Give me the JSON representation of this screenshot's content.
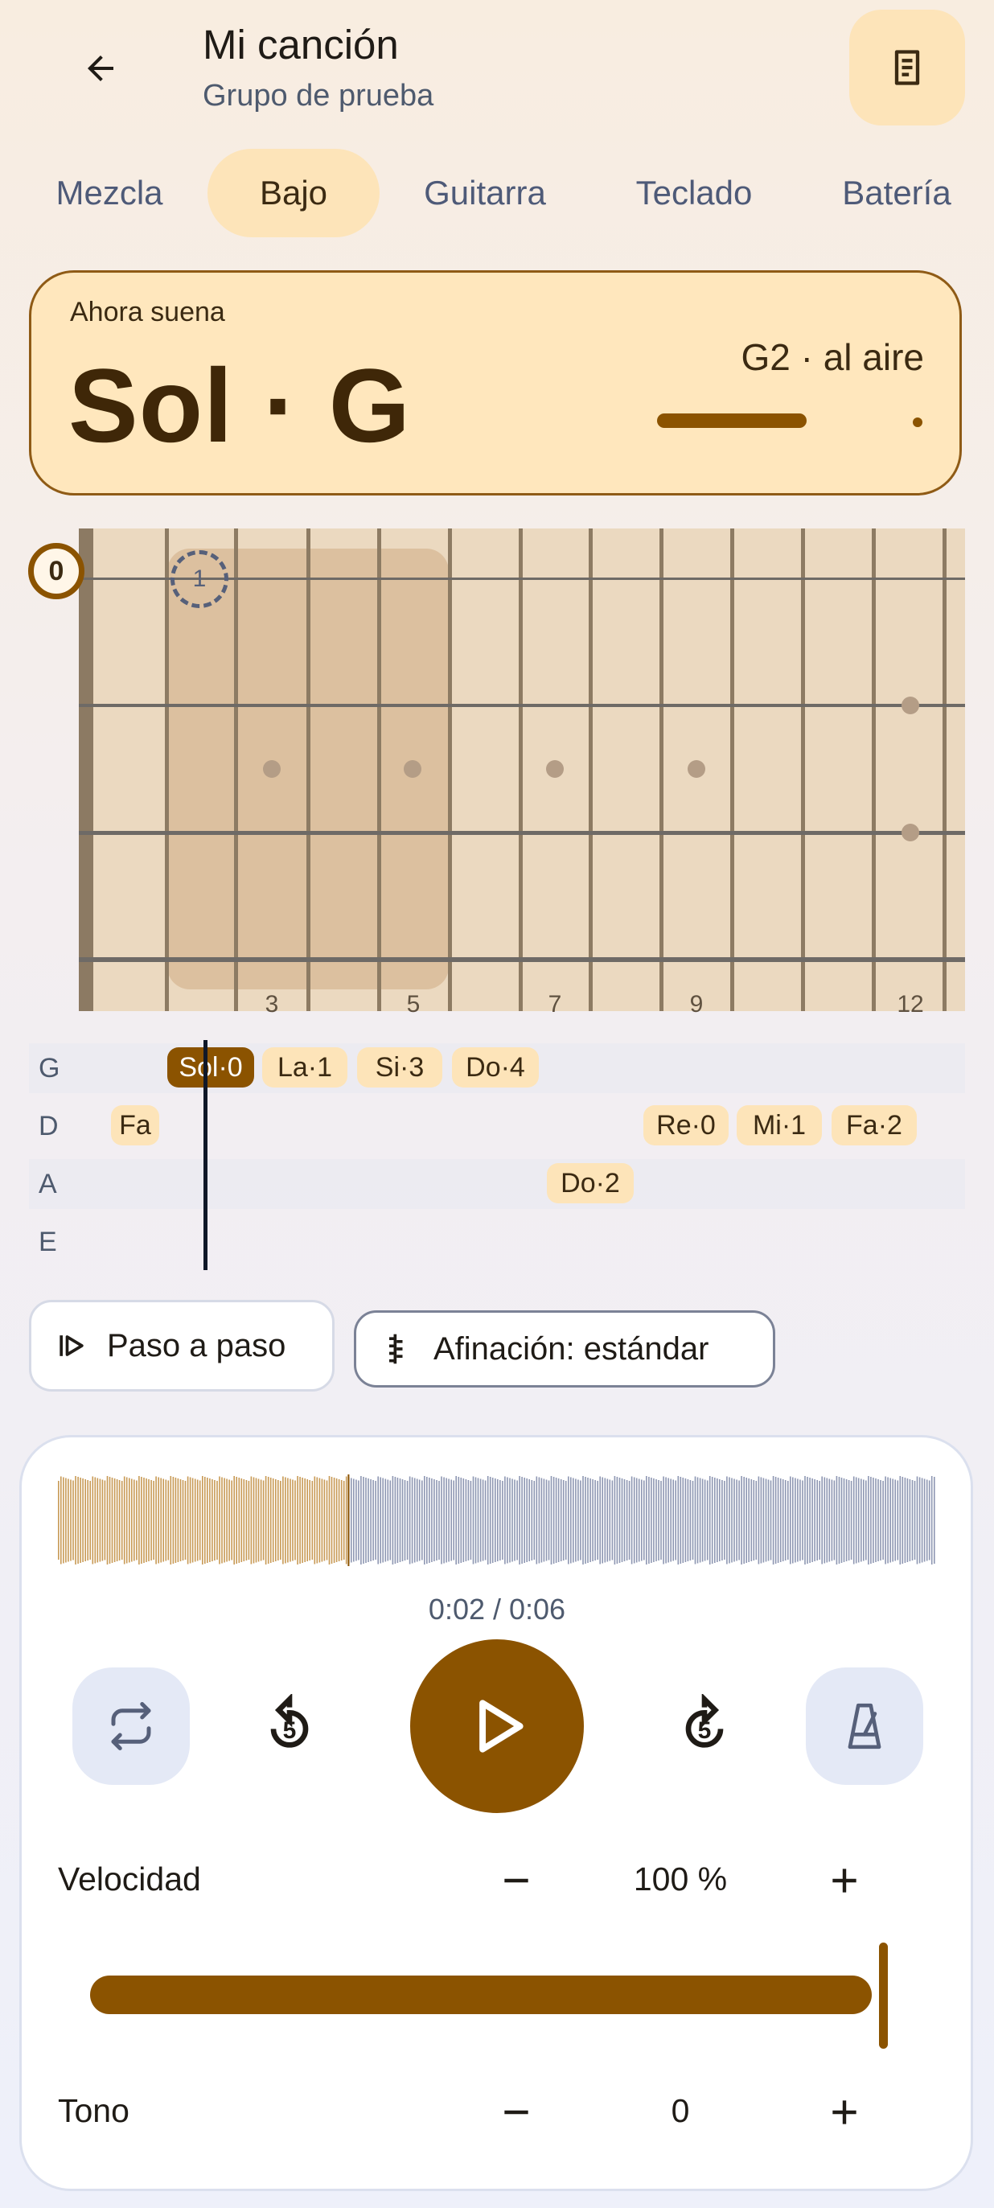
{
  "header": {
    "title": "Mi canción",
    "subtitle": "Grupo de prueba",
    "back_icon": "arrow-back-icon",
    "doc_icon": "document-icon"
  },
  "tabs": [
    {
      "label": "Mezcla",
      "active": false
    },
    {
      "label": "Bajo",
      "active": true
    },
    {
      "label": "Guitarra",
      "active": false
    },
    {
      "label": "Teclado",
      "active": false
    },
    {
      "label": "Batería",
      "active": false
    }
  ],
  "now_playing": {
    "label": "Ahora suena",
    "note": "Sol · G",
    "detail": "G2 · al aire"
  },
  "fretboard": {
    "fret_numbers": [
      "3",
      "5",
      "7",
      "9",
      "12"
    ],
    "open_marker": "0",
    "finger_marker": "1"
  },
  "tab_rows": [
    {
      "string": "G",
      "notes": [
        "Sol·0",
        "La·1",
        "Si·3",
        "Do·4"
      ]
    },
    {
      "string": "D",
      "notes": [
        "Fa",
        "Re·0",
        "Mi·1",
        "Fa·2"
      ]
    },
    {
      "string": "A",
      "notes": [
        "Do·2"
      ]
    },
    {
      "string": "E",
      "notes": []
    }
  ],
  "buttons": {
    "step": "Paso a paso",
    "tuning": "Afinación: estándar"
  },
  "player": {
    "time": "0:02 / 0:06",
    "progress": 0.33,
    "replay_seconds": "5",
    "forward_seconds": "5",
    "speed_label": "Velocidad",
    "speed_value": "100 %",
    "speed_fraction": 1.0,
    "pitch_label": "Tono",
    "pitch_value": "0"
  },
  "colors": {
    "accent": "#8b5300",
    "chip": "#fde4b9",
    "played_wave": "#c89a55",
    "unplayed_wave": "#8e97b2"
  }
}
